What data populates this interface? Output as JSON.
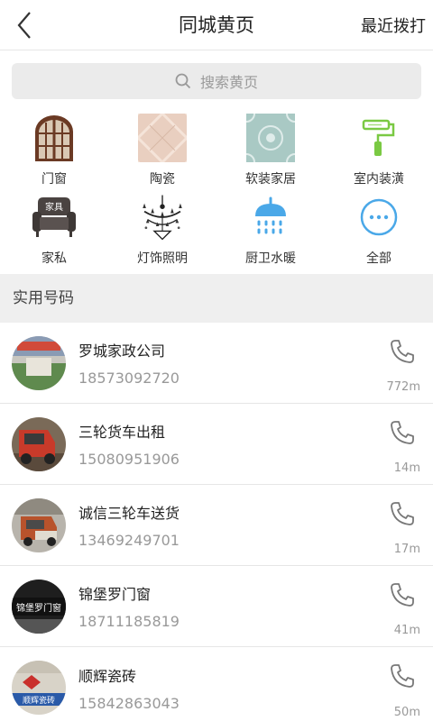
{
  "header": {
    "title": "同城黄页",
    "recent_label": "最近拨打"
  },
  "search": {
    "placeholder": "搜索黄页"
  },
  "categories": [
    {
      "label": "门窗",
      "icon": "window-icon"
    },
    {
      "label": "陶瓷",
      "icon": "tile-icon"
    },
    {
      "label": "软装家居",
      "icon": "wallpaper-icon"
    },
    {
      "label": "室内装潢",
      "icon": "paint-roller-icon"
    },
    {
      "label": "家私",
      "icon": "sofa-icon"
    },
    {
      "label": "灯饰照明",
      "icon": "chandelier-icon"
    },
    {
      "label": "厨卫水暖",
      "icon": "shower-icon"
    },
    {
      "label": "全部",
      "icon": "more-icon"
    }
  ],
  "section": {
    "title": "实用号码"
  },
  "contacts": [
    {
      "name": "罗城家政公司",
      "phone": "18573092720",
      "distance": "772m"
    },
    {
      "name": "三轮货车出租",
      "phone": "15080951906",
      "distance": "14m"
    },
    {
      "name": "诚信三轮车送货",
      "phone": "13469249701",
      "distance": "17m"
    },
    {
      "name": "锦堡罗门窗",
      "phone": "18711185819",
      "distance": "41m"
    },
    {
      "name": "顺辉瓷砖",
      "phone": "15842863043",
      "distance": "50m"
    }
  ],
  "avatar_text": {
    "sofa_sign": "家具",
    "shop_sign": "锦堡罗门窗",
    "tile_sign": "顺辉瓷砖"
  },
  "colors": {
    "accent_blue": "#4aa8e8",
    "accent_green": "#7ac943",
    "text_gray": "#999999"
  }
}
